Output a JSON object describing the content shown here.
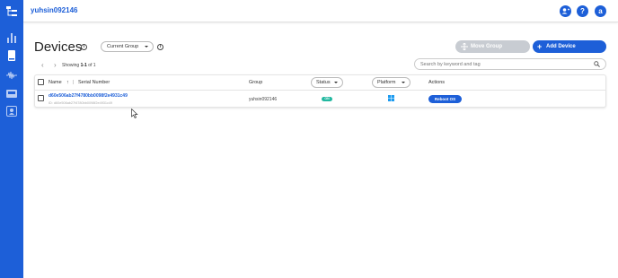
{
  "header": {
    "workspace": "yuhsin092146",
    "add_user_icon": "add-user-icon",
    "help_icon": "help-icon",
    "account_icon": "account-icon",
    "help_glyph": "?",
    "account_glyph": "a"
  },
  "sidebar": {
    "items": [
      {
        "icon": "hierarchy-icon"
      },
      {
        "icon": "bar-chart-icon"
      },
      {
        "icon": "device-icon"
      },
      {
        "icon": "pulse-icon"
      },
      {
        "icon": "inbox-icon"
      },
      {
        "icon": "user-badge-icon"
      }
    ]
  },
  "toolbar": {
    "title": "Devices",
    "group_select": "Current Group",
    "move_group": "Move Group",
    "add_device": "Add Device"
  },
  "pager": {
    "prefix": "Showing ",
    "range": "1-1",
    "suffix": " of 1",
    "search_placeholder": "Search by keyword and tag"
  },
  "table": {
    "columns": {
      "name": "Name",
      "serial": "Serial Number",
      "group": "Group",
      "status": "Status",
      "platform": "Platform",
      "actions": "Actions"
    },
    "rows": [
      {
        "serial": "d60e506ab27f4780bb0098f2e4931c49",
        "sub_id": "ID: d60e506ab27f4780bb0098f2e4931c49",
        "group": "yuhsin092146",
        "status": "ON",
        "platform_icon": "windows-icon",
        "action": "Reboot OS"
      }
    ]
  },
  "colors": {
    "primary": "#1d5fd8",
    "status_on": "#22b8a0",
    "disabled": "#c8ccd2"
  }
}
